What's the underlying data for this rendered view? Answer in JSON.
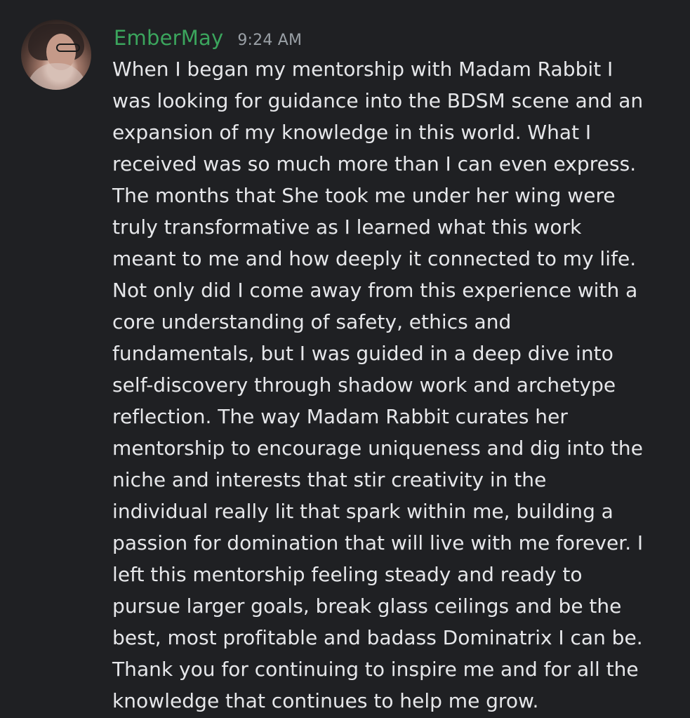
{
  "message": {
    "username": "EmberMay",
    "timestamp": "9:24 AM",
    "lines": [
      "When I began my mentorship with Madam Rabbit I",
      "was looking for guidance into the BDSM scene and an",
      "expansion of my knowledge in this world. What I",
      "received was so much more than I can even express.",
      "The months that She took me under her wing were",
      "truly transformative as I learned what this work",
      "meant to me and how deeply it connected to my life.",
      "Not only did I come away from this experience with a",
      "core understanding of safety, ethics and",
      "fundamentals, but I was guided in a deep dive into",
      "self-discovery through shadow work and archetype",
      "reflection. The way Madam Rabbit curates her",
      "mentorship to encourage uniqueness and dig into the",
      "niche and interests that stir creativity in the",
      "individual really lit that spark within me, building a",
      "passion for domination that will live with me forever. I",
      "left this mentorship feeling steady and ready to",
      "pursue larger goals, break glass ceilings and be the",
      "best, most profitable and badass Dominatrix I can be.",
      "Thank you for continuing to inspire me and for all the",
      "knowledge that continues to help me grow."
    ]
  },
  "colors": {
    "background": "#1f2023",
    "username": "#3ba55d",
    "timestamp": "#9aa0a6",
    "text": "#e6e7ea"
  }
}
